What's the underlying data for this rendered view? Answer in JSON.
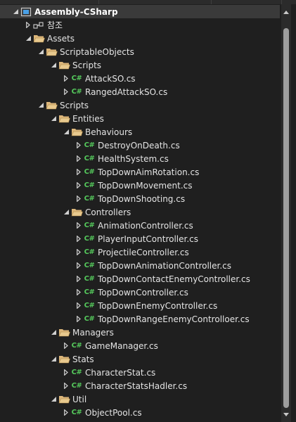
{
  "colors": {
    "folder": "#dcb67a",
    "csharp": "#55c95c",
    "background": "#1f1f1f",
    "selected": "#3a3a3a"
  },
  "tree": [
    {
      "label": "Assembly-CSharp",
      "depth": 0,
      "icon": "project-icon",
      "arrow": "expanded",
      "bold": true,
      "selected": true
    },
    {
      "label": "참조",
      "depth": 1,
      "icon": "references-icon",
      "arrow": "collapsed"
    },
    {
      "label": "Assets",
      "depth": 1,
      "icon": "folder-open-icon",
      "arrow": "expanded"
    },
    {
      "label": "ScriptableObjects",
      "depth": 2,
      "icon": "folder-open-icon",
      "arrow": "expanded"
    },
    {
      "label": "Scripts",
      "depth": 3,
      "icon": "folder-open-icon",
      "arrow": "expanded"
    },
    {
      "label": "AttackSO.cs",
      "depth": 4,
      "icon": "csharp-file-icon",
      "arrow": "collapsed"
    },
    {
      "label": "RangedAttackSO.cs",
      "depth": 4,
      "icon": "csharp-file-icon",
      "arrow": "collapsed"
    },
    {
      "label": "Scripts",
      "depth": 2,
      "icon": "folder-open-icon",
      "arrow": "expanded"
    },
    {
      "label": "Entities",
      "depth": 3,
      "icon": "folder-open-icon",
      "arrow": "expanded"
    },
    {
      "label": "Behaviours",
      "depth": 4,
      "icon": "folder-open-icon",
      "arrow": "expanded"
    },
    {
      "label": "DestroyOnDeath.cs",
      "depth": 5,
      "icon": "csharp-file-icon",
      "arrow": "collapsed"
    },
    {
      "label": "HealthSystem.cs",
      "depth": 5,
      "icon": "csharp-file-icon",
      "arrow": "collapsed"
    },
    {
      "label": "TopDownAimRotation.cs",
      "depth": 5,
      "icon": "csharp-file-icon",
      "arrow": "collapsed"
    },
    {
      "label": "TopDownMovement.cs",
      "depth": 5,
      "icon": "csharp-file-icon",
      "arrow": "collapsed"
    },
    {
      "label": "TopDownShooting.cs",
      "depth": 5,
      "icon": "csharp-file-icon",
      "arrow": "collapsed"
    },
    {
      "label": "Controllers",
      "depth": 4,
      "icon": "folder-open-icon",
      "arrow": "expanded"
    },
    {
      "label": "AnimationController.cs",
      "depth": 5,
      "icon": "csharp-file-icon",
      "arrow": "collapsed"
    },
    {
      "label": "PlayerInputController.cs",
      "depth": 5,
      "icon": "csharp-file-icon",
      "arrow": "collapsed"
    },
    {
      "label": "ProjectileController.cs",
      "depth": 5,
      "icon": "csharp-file-icon",
      "arrow": "collapsed"
    },
    {
      "label": "TopDownAnimationController.cs",
      "depth": 5,
      "icon": "csharp-file-icon",
      "arrow": "collapsed"
    },
    {
      "label": "TopDownContactEnemyController.cs",
      "depth": 5,
      "icon": "csharp-file-icon",
      "arrow": "collapsed"
    },
    {
      "label": "TopDownController.cs",
      "depth": 5,
      "icon": "csharp-file-icon",
      "arrow": "collapsed"
    },
    {
      "label": "TopDownEnemyController.cs",
      "depth": 5,
      "icon": "csharp-file-icon",
      "arrow": "collapsed"
    },
    {
      "label": "TopDownRangeEnemyControlloer.cs",
      "depth": 5,
      "icon": "csharp-file-icon",
      "arrow": "collapsed"
    },
    {
      "label": "Managers",
      "depth": 3,
      "icon": "folder-open-icon",
      "arrow": "expanded"
    },
    {
      "label": "GameManager.cs",
      "depth": 4,
      "icon": "csharp-file-icon",
      "arrow": "collapsed"
    },
    {
      "label": "Stats",
      "depth": 3,
      "icon": "folder-open-icon",
      "arrow": "expanded"
    },
    {
      "label": "CharacterStat.cs",
      "depth": 4,
      "icon": "csharp-file-icon",
      "arrow": "collapsed"
    },
    {
      "label": "CharacterStatsHadler.cs",
      "depth": 4,
      "icon": "csharp-file-icon",
      "arrow": "collapsed"
    },
    {
      "label": "Util",
      "depth": 3,
      "icon": "folder-open-icon",
      "arrow": "expanded"
    },
    {
      "label": "ObjectPool.cs",
      "depth": 4,
      "icon": "csharp-file-icon",
      "arrow": "collapsed"
    }
  ],
  "icons": {
    "csharp_glyph": "C#"
  }
}
